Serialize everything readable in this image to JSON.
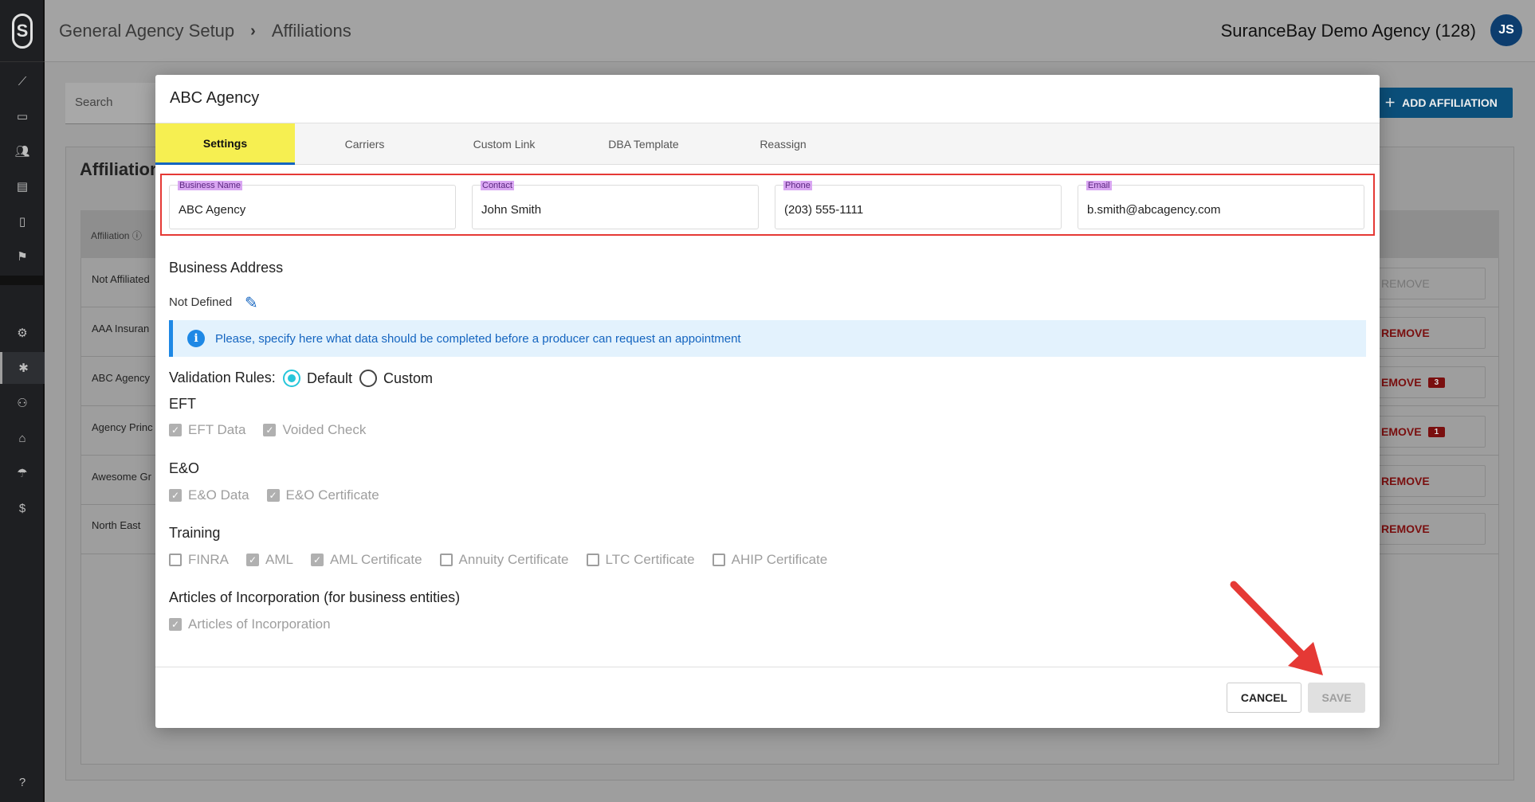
{
  "colors": {
    "accent": "#1565c0",
    "active_tab": "#f6ef51",
    "highlight_border": "#e53935",
    "label_bg": "#d9a6f2",
    "danger": "#7a0f0f"
  },
  "header": {
    "breadcrumb": [
      "General Agency Setup",
      "Affiliations"
    ],
    "agency_name": "SuranceBay Demo Agency (128)",
    "avatar_initials": "JS"
  },
  "sidebar": {
    "icons": [
      "analytics-icon",
      "monitor-icon",
      "people-icon",
      "store-icon",
      "document-icon",
      "flag-icon",
      "gear-icon",
      "star-icon",
      "user-settings-icon",
      "bank-icon",
      "umbrella-icon",
      "dollar-icon",
      "help-icon"
    ]
  },
  "background": {
    "search_placeholder": "Search",
    "add_affiliation_label": "ADD AFFILIATION",
    "card_title": "Affiliation",
    "table_header": "Affiliation",
    "rows": [
      {
        "label": "Not Affiliated",
        "action": "REMOVE",
        "badge": ""
      },
      {
        "label": "AAA Insuran",
        "action": "REMOVE",
        "badge": ""
      },
      {
        "label": "ABC Agency",
        "action": "EMOVE",
        "badge": "3"
      },
      {
        "label": "Agency Princ",
        "action": "EMOVE",
        "badge": "1"
      },
      {
        "label": "Awesome Gr",
        "action": "REMOVE",
        "badge": ""
      },
      {
        "label": "North East",
        "action": "REMOVE",
        "badge": ""
      }
    ]
  },
  "modal": {
    "title": "ABC Agency",
    "tabs": [
      "Settings",
      "Carriers",
      "Custom Link",
      "DBA Template",
      "Reassign"
    ],
    "fields": [
      {
        "label": "Business Name",
        "value": "ABC Agency"
      },
      {
        "label": "Contact",
        "value": "John Smith"
      },
      {
        "label": "Phone",
        "value": "(203) 555-1111"
      },
      {
        "label": "Email",
        "value": "b.smith@abcagency.com"
      }
    ],
    "business_address_title": "Business Address",
    "business_address_value": "Not Defined",
    "info_message": "Please, specify here what data should be completed before a producer can request an appointment",
    "validation_label": "Validation Rules:",
    "validation_options": [
      "Default",
      "Custom"
    ],
    "validation_selected": "Default",
    "sections": [
      {
        "title": "EFT",
        "items": [
          {
            "label": "EFT Data",
            "checked": true
          },
          {
            "label": "Voided Check",
            "checked": true
          }
        ]
      },
      {
        "title": "E&O",
        "items": [
          {
            "label": "E&O Data",
            "checked": true
          },
          {
            "label": "E&O Certificate",
            "checked": true
          }
        ]
      },
      {
        "title": "Training",
        "items": [
          {
            "label": "FINRA",
            "checked": false
          },
          {
            "label": "AML",
            "checked": true
          },
          {
            "label": "AML Certificate",
            "checked": true
          },
          {
            "label": "Annuity Certificate",
            "checked": false
          },
          {
            "label": "LTC Certificate",
            "checked": false
          },
          {
            "label": "AHIP Certificate",
            "checked": false
          }
        ]
      },
      {
        "title": "Articles of Incorporation (for business entities)",
        "items": [
          {
            "label": "Articles of Incorporation",
            "checked": true
          }
        ]
      }
    ],
    "cancel_label": "CANCEL",
    "save_label": "SAVE"
  }
}
